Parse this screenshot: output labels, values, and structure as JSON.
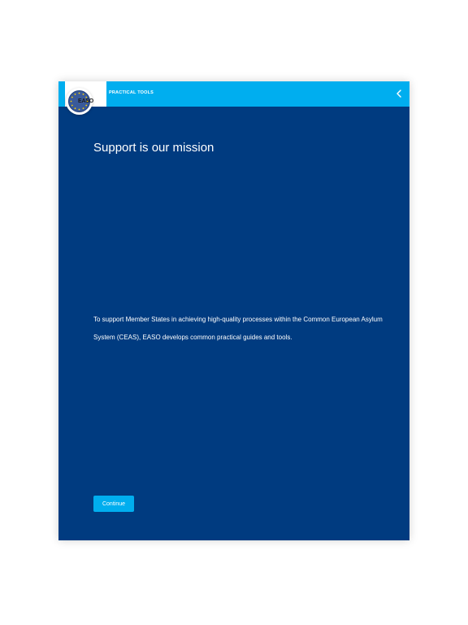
{
  "header": {
    "logo_text": "EASO",
    "title": "PRACTICAL TOOLS",
    "back_icon": "chevron-left-icon"
  },
  "main": {
    "headline": "Support is our mission",
    "body": "To support Member States in achieving high-quality processes within the Common European Asylum System (CEAS), EASO develops common practical guides and tools.",
    "continue_label": "Continue"
  },
  "colors": {
    "background": "#003b80",
    "topbar": "#00aeef",
    "button": "#00aeef",
    "text": "#ffffff"
  }
}
